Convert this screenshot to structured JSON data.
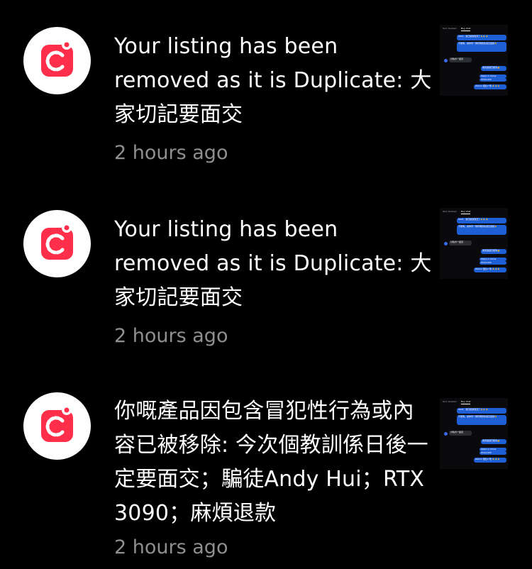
{
  "app": {
    "name": "Carousell",
    "accent": "#ff2f4b"
  },
  "notifications": [
    {
      "message": "Your listing has been removed as it is Duplicate: 大家切記要面交",
      "time": "2 hours ago",
      "thumbnail": {
        "tabs": [
          "Item Deleted",
          "Buy chat"
        ],
        "bubbles": [
          "SGW：我已經收到貨了🙏🙏🙏",
          "不能喺，請你同一群有問題的退貨退錢🙏",
          "付咗😡一起走",
          "收到退錢已經到👍",
          "Made in China",
          "HK$4,000",
          "Return 個比2 唔 🙏🙏🙏"
        ]
      }
    },
    {
      "message": "Your listing has been removed as it is Duplicate: 大家切記要面交",
      "time": "2 hours ago",
      "thumbnail": {
        "tabs": [
          "Item Deleted",
          "Buy chat"
        ],
        "bubbles": [
          "SGW：我已經收到貨了🙏🙏🙏",
          "不能喺，請你同一群有問題的退貨退錢🙏",
          "付咗😡一起走",
          "收到退錢已經到👍",
          "Made in China",
          "HK$4,000",
          "Return 個比2 唔 🙏🙏🙏"
        ]
      }
    },
    {
      "message": "你嘅產品因包含冒犯性行為或內容已被移除: 今次個教訓係日後一定要面交；騙徒Andy Hui；RTX 3090；麻煩退款",
      "time": "2 hours ago",
      "thumbnail": {
        "tabs": [
          "Item Deleted",
          "Buy chat"
        ],
        "bubbles": [
          "SGW：我已經收到貨了🙏🙏🙏",
          "不能喺，請你同一群有問題的退貨退錢🙏",
          "付咗😡一起走",
          "收到退錢已經到👍",
          "Made in China",
          "HK$4,000",
          "Return 個比2 唔 🙏🙏🙏"
        ]
      }
    }
  ]
}
